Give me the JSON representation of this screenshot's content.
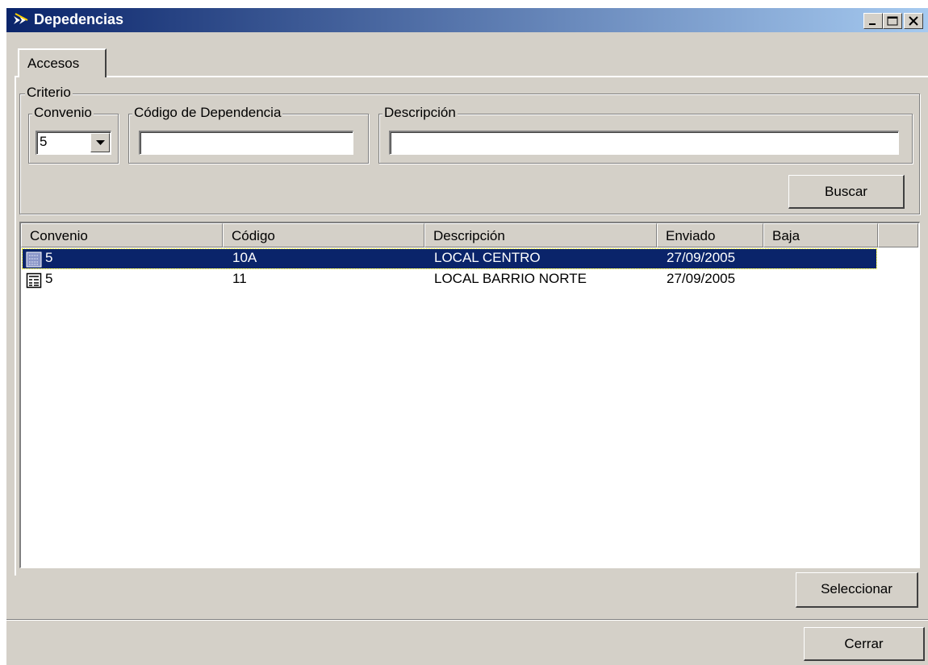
{
  "window": {
    "title": "Depedencias",
    "icon": "app-arrow-icon"
  },
  "titlebar_buttons": [
    "minimize-icon",
    "maximize-icon",
    "close-icon"
  ],
  "tabs": [
    {
      "label": "Accesos"
    }
  ],
  "criteria": {
    "title": "Criterio",
    "convenio": {
      "label": "Convenio",
      "value": "5"
    },
    "codigo": {
      "label": "Código de Dependencia",
      "value": ""
    },
    "descripcion": {
      "label": "Descripción",
      "value": ""
    },
    "search_button": "Buscar"
  },
  "list": {
    "columns": [
      "Convenio",
      "Código",
      "Descripción",
      "Enviado",
      "Baja"
    ],
    "rows": [
      {
        "convenio": "5",
        "codigo": "10A",
        "descripcion": "LOCAL CENTRO",
        "enviado": "27/09/2005",
        "baja": "",
        "selected": true
      },
      {
        "convenio": "5",
        "codigo": "11",
        "descripcion": "LOCAL BARRIO NORTE",
        "enviado": "27/09/2005",
        "baja": "",
        "selected": false
      }
    ]
  },
  "buttons": {
    "select": "Seleccionar",
    "close": "Cerrar"
  },
  "colors": {
    "titlebar": "#0a246a",
    "selection": "#0a246a",
    "face": "#d4d0c8"
  }
}
